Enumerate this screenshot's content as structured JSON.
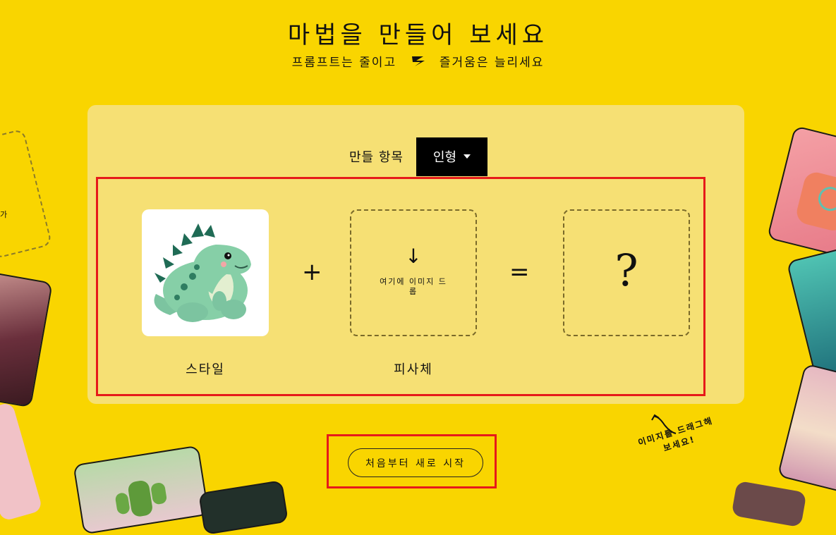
{
  "header": {
    "title": "마법을 만들어 보세요",
    "subtitle_left": "프롬프트는 줄이고",
    "subtitle_right": "즐거움은 늘리세요"
  },
  "make": {
    "label": "만들 항목",
    "selected": "인형"
  },
  "cards": {
    "style_label": "스타일",
    "subject_label": "피사체",
    "drop_arrow": "↓",
    "drop_text": "여기에 이미지 드롭",
    "result_symbol": "?"
  },
  "operators": {
    "plus": "+",
    "equals": "="
  },
  "restart_label": "처음부터 새로 시작",
  "hint": {
    "line1": "이미지를 드래그해",
    "line2": "보세요!"
  },
  "left_card_fragment": "가",
  "colors": {
    "background": "#F9D500",
    "panel": "#F6E074",
    "highlight": "#E61A1A",
    "dropdown": "#000000"
  }
}
